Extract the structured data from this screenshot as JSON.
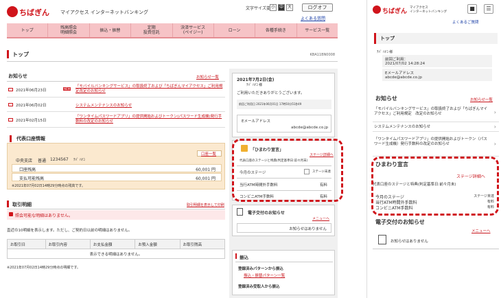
{
  "brand": {
    "name": "ちばぎん",
    "sub": "マイアクセス インターネットバンキング",
    "sub_mobile_1": "マイアクセス",
    "sub_mobile_2": "インターネットバンキング"
  },
  "header": {
    "text_size_label": "文字サイズ変更",
    "size_small": "小",
    "size_mid": "中",
    "size_large": "大",
    "logout": "ログオフ",
    "faq": "よくある質問"
  },
  "nav": [
    "トップ",
    "残高照会\n明細照会",
    "振込・振替",
    "定期\n投資信託",
    "決済サービス\n(ペイジー)",
    "ローン",
    "各種手続き",
    "サービス一覧"
  ],
  "page": {
    "title": "トップ",
    "code": "KBA11BN0008"
  },
  "news": {
    "title": "お知らせ",
    "list_link": "お知らせ一覧",
    "items": [
      {
        "date": "2021年06月23日",
        "badge": "NEW",
        "text": "「モバイルバンキングサービス」の取扱終了および「ちばぎんマイアクセス」ご利用規定改定のお知らせ"
      },
      {
        "date": "2021年06月02日",
        "badge": "",
        "text": "システムメンテナンスのお知らせ"
      },
      {
        "date": "2021年02月15日",
        "badge": "",
        "text": "「ワンタイムパスワードアプリ」の提供開始およびトークン(パスワード生成機)発行手数料の改定のお知らせ"
      }
    ]
  },
  "account": {
    "title": "代表口座情報",
    "list_link": "口座一覧",
    "branch": "中央支店",
    "type": "普通",
    "number": "1234567",
    "holder": "ﾁﾊﾞ ﾊﾅｺ",
    "balance_label": "口座残高",
    "balance": "60,001 円",
    "available_label": "支払可能残高",
    "available": "60,001 円",
    "note": "※2021年07月02日14時29分時点の残高です。"
  },
  "transactions": {
    "title": "取引明細",
    "print_link": "取引明細を表示して印刷",
    "warn": "照会可能な明細はありません。",
    "info": "直近の10明細を表示します。ただし、ご契約日以前の明細はありません。",
    "columns": [
      "お取引日",
      "お取引内容",
      "お支払金額",
      "お預入金額",
      "お取引残高"
    ],
    "empty": "表示できる明細はありません。",
    "note": "※2021年07月02日14時29分時点の明細です。"
  },
  "welcome": {
    "date": "2021年7月2日(金)",
    "name": "ﾁﾊﾞ ﾊﾅｺ 様",
    "greet": "ご利用いただきありがとうございます。",
    "last_login": "前回ご利用日 2021年06月01日 17時50分51秒49",
    "email_label": "Eメールアドレス",
    "email": "abcde@abcde.co.jp"
  },
  "himawari": {
    "title": "「ひまわり宣言」",
    "detail": "ステージ詳細へ",
    "desc": "代表口座のステージと特典(判定基準日:前々月末)",
    "rows": [
      {
        "label": "今月のステージ",
        "value": "ステージ未達"
      },
      {
        "label": "当行ATM時間外手数料",
        "value": "有料"
      },
      {
        "label": "コンビニATM手数料",
        "value": "有料"
      }
    ]
  },
  "edoc": {
    "title": "電子交付のお知らせ",
    "menu": "メニューへ",
    "none": "お知らせはありません"
  },
  "furikomi": {
    "title": "振込",
    "pattern": "登録済みパターンから振込",
    "list": "振込・振替パターン一覧",
    "registered": "登録済み受取人から振込"
  },
  "mobile": {
    "faq": "よくあるご質問",
    "top": "トップ",
    "name": "ﾁﾊﾞ ﾊﾅｺ 様",
    "last_label": "前回ご利用：",
    "last_value": "2021/07/02 14:28:24",
    "email_label": "Eメールアドレス",
    "email": "abcde@abcde.co.jp",
    "news_title": "お知らせ",
    "news_list": "お知らせ一覧",
    "news": [
      "「モバイルバンキングサービス」の取扱終了および「ちばぎんマイアクセス」ご利用規定　改定のお知らせ",
      "システムメンテナンスのお知らせ",
      "「ワンタイムパスワードアプリ」の提供開始およびトークン（パスワード生成機）発行手数料の改定のお知らせ"
    ],
    "hima_title": "ひまわり宣言",
    "hima_detail": "ステージ詳細へ",
    "hima_desc": "代表口座のステージと特典(判定基準日:前々月末)",
    "hima_rows": [
      {
        "label": "今月のステージ",
        "value": "ステージ未達"
      },
      {
        "label": "当行ATM時間外手数料",
        "value": "有料"
      },
      {
        "label": "コンビニATM手数料",
        "value": "有料"
      }
    ],
    "edoc_title": "電子交付のお知らせ",
    "edoc_menu": "メニューへ",
    "edoc_none": "お知らせはありません"
  },
  "colors": {
    "brand_red": "#d0141b",
    "nav_pink": "#f6c3c6",
    "account_bg": "#fbe9cf"
  }
}
